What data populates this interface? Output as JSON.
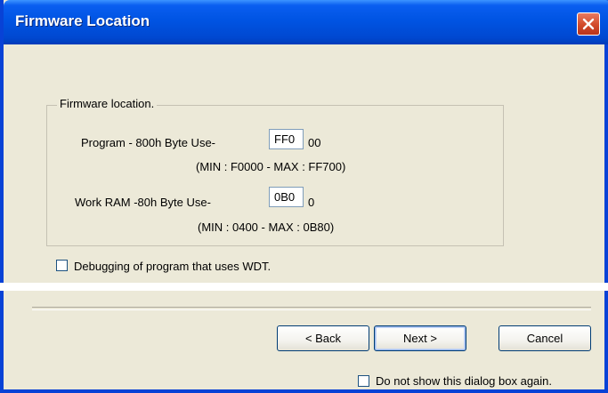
{
  "window": {
    "title": "Firmware Location",
    "close_icon": "close-icon"
  },
  "group": {
    "title": "Firmware location.",
    "program_label": "Program - 800h Byte Use-",
    "program_value": "FF0",
    "program_suffix": "00",
    "program_range": "(MIN : F0000  -  MAX : FF700)",
    "work_label": "Work RAM -80h Byte Use-",
    "work_value": "0B0",
    "work_suffix": "0",
    "work_range": "(MIN : 0400  -  MAX : 0B80)"
  },
  "debug_checkbox": {
    "label": "Debugging of program that uses WDT.",
    "checked": false
  },
  "buttons": {
    "back": "< Back",
    "next": "Next >",
    "cancel": "Cancel"
  },
  "no_show_checkbox": {
    "label": "Do not show this dialog box again.",
    "checked": false
  },
  "colors": {
    "titlebar": "#0054e3",
    "dialog_bg": "#ece9d8",
    "close_button": "#d24a2a"
  }
}
